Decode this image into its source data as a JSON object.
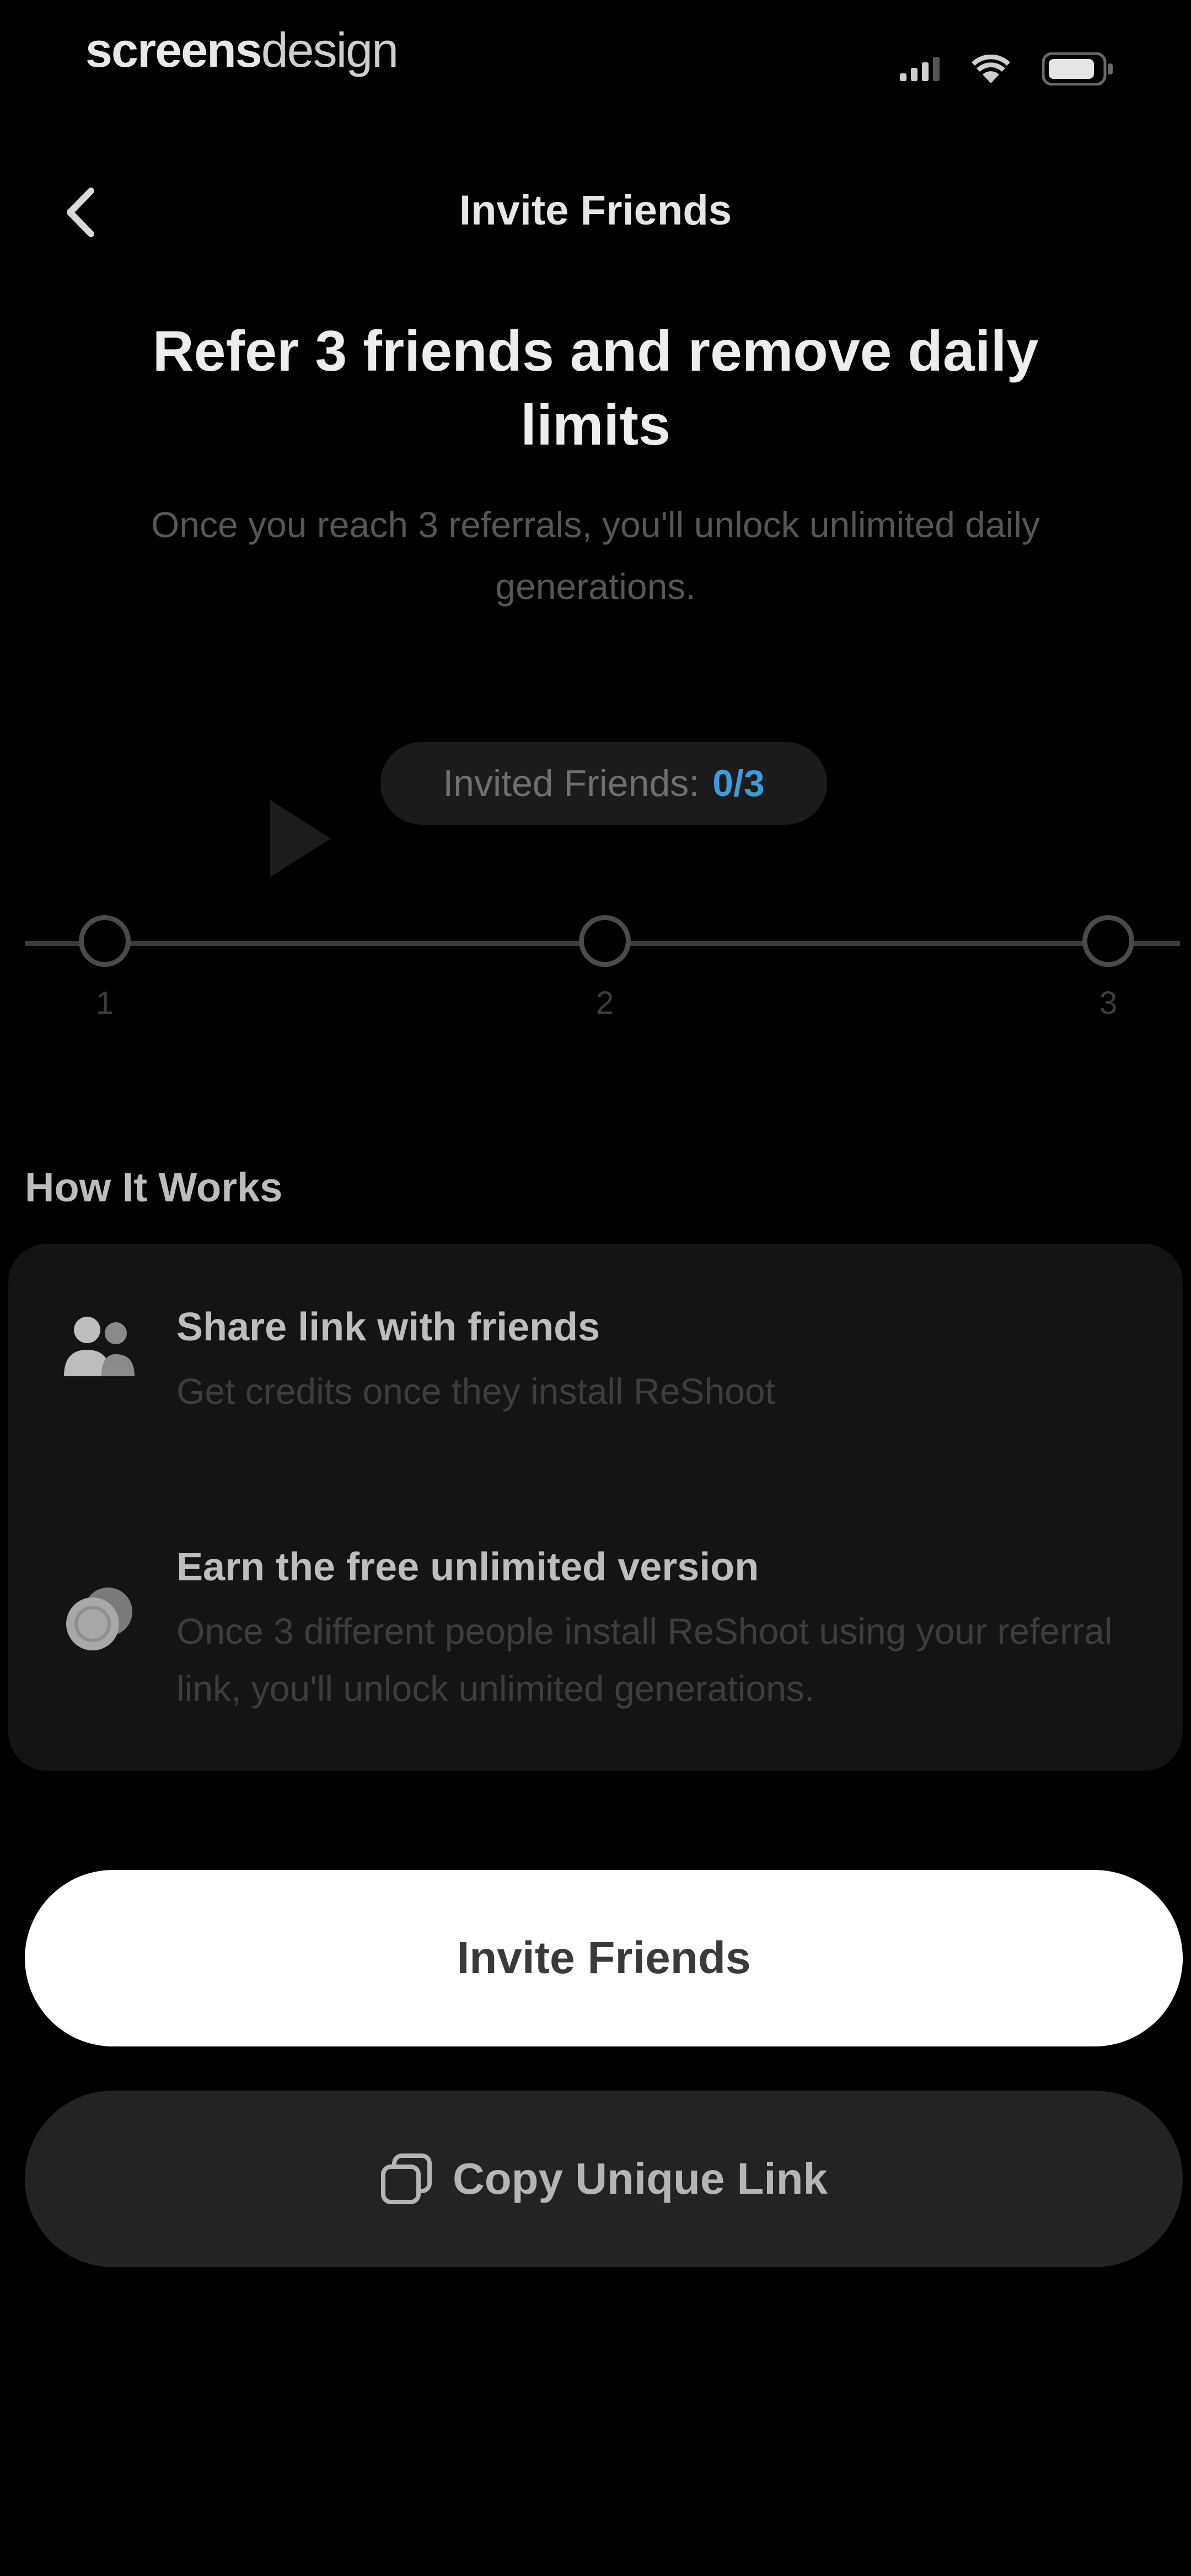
{
  "status_bar": {
    "brand_part1": "screens",
    "brand_part2": "design"
  },
  "nav": {
    "title": "Invite Friends",
    "back_icon": "chevron-left-icon"
  },
  "hero": {
    "headline": "Refer 3 friends and remove daily limits",
    "subtext": "Once you reach 3 referrals, you'll unlock unlimited daily generations."
  },
  "invite_counter": {
    "label": "Invited Friends:",
    "value": "0/3",
    "invited": 0,
    "goal": 3,
    "accent_color": "#3b9cd8"
  },
  "progress": {
    "steps": [
      "1",
      "2",
      "3"
    ],
    "fraction": 0
  },
  "how_it_works": {
    "title": "How It Works",
    "items": [
      {
        "icon": "share-people-icon",
        "title": "Share link with friends",
        "description": "Get credits once they install ReShoot"
      },
      {
        "icon": "coins-icon",
        "title": "Earn the free unlimited version",
        "description": "Once 3 different people install ReShoot using your referral link, you'll unlock unlimited generations."
      }
    ]
  },
  "actions": {
    "invite_label": "Invite Friends",
    "copy_label": "Copy Unique Link",
    "copy_icon": "copy-icon"
  },
  "colors": {
    "background": "#000000",
    "card": "#141414",
    "primary_button": "#ffffff",
    "secondary_button": "#232323"
  }
}
